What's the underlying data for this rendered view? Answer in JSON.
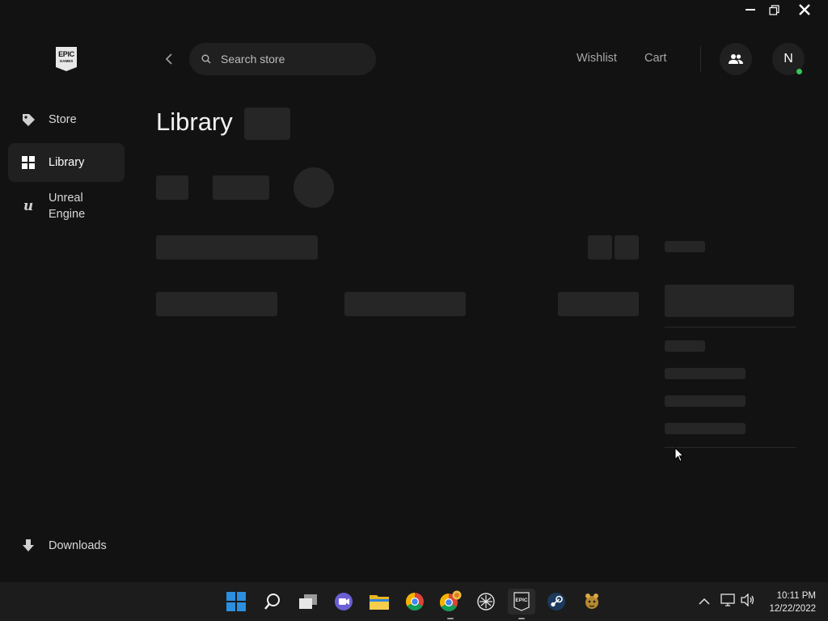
{
  "window": {
    "controls": [
      "minimize",
      "restore",
      "close"
    ]
  },
  "sidebar": {
    "logo_text_top": "EPIC",
    "logo_text_bottom": "GAMES",
    "items": [
      {
        "label": "Store",
        "icon": "tag-icon",
        "active": false
      },
      {
        "label": "Library",
        "icon": "grid-icon",
        "active": true
      },
      {
        "label_line1": "Unreal",
        "label_line2": "Engine",
        "icon": "unreal-icon",
        "active": false
      }
    ],
    "downloads_label": "Downloads"
  },
  "header": {
    "search_placeholder": "Search store",
    "wishlist_label": "Wishlist",
    "cart_label": "Cart",
    "avatar_initial": "N",
    "online_status_color": "#34c759"
  },
  "main": {
    "title": "Library"
  },
  "taskbar": {
    "time": "10:11 PM",
    "date": "12/22/2022",
    "apps": [
      "start-icon",
      "search-icon",
      "task-view-icon",
      "teams-chat-icon",
      "file-explorer-icon",
      "chrome-icon",
      "chrome-profile-icon",
      "app-icon",
      "epic-games-icon",
      "steam-icon",
      "game-icon"
    ]
  },
  "colors": {
    "background": "#121212",
    "surface": "#202020",
    "skeleton": "#262626",
    "accent_windows": "#0078d4"
  }
}
